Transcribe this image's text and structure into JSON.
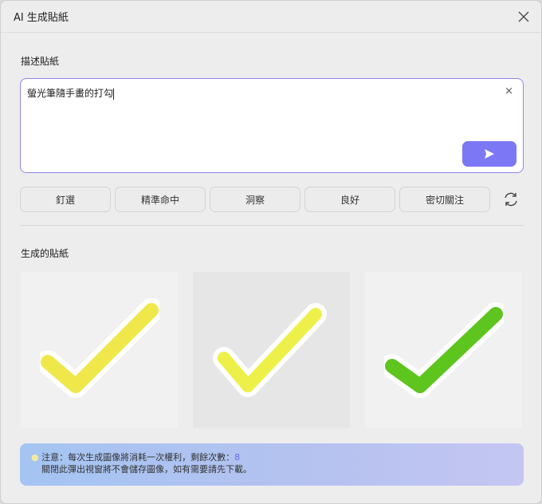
{
  "title": "AI 生成貼紙",
  "describe_label": "描述貼紙",
  "input_value": "螢光筆隨手畫的打勾",
  "clear_label": "×",
  "chips": [
    "釘選",
    "精準命中",
    "洞察",
    "良好",
    "密切關注"
  ],
  "generated_label": "生成的貼紙",
  "stickers": [
    {
      "color": "#f0e84a"
    },
    {
      "color": "#eef04a"
    },
    {
      "color": "#5ec41e"
    }
  ],
  "notice": {
    "line1": "注意：每次生成圖像將消耗一次權利，剩餘次數：",
    "count": "8",
    "line2": "關閉此彈出視窗將不會儲存圖像，如有需要請先下載。"
  },
  "colors": {
    "accent": "#7c78f5"
  }
}
